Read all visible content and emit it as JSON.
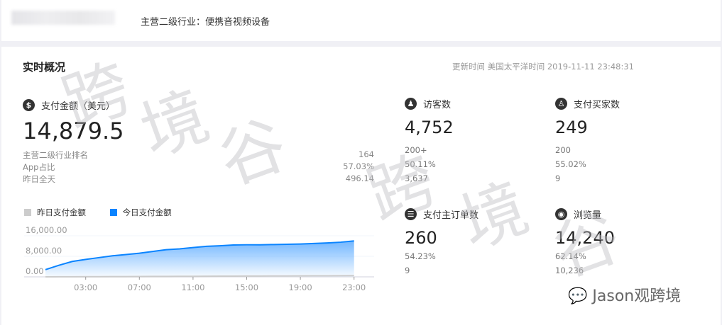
{
  "header": {
    "industry": "主营二级行业：便携音视频设备"
  },
  "panel": {
    "title": "实时概况",
    "update_time": "更新时间 美国太平洋时间 2019-11-11 23:48:31"
  },
  "payment": {
    "label": "支付金额（美元）",
    "value": "14,879.5",
    "rows": [
      {
        "label": "主营二级行业排名",
        "value": "164"
      },
      {
        "label": "App占比",
        "value": "57.03%"
      },
      {
        "label": "昨日全天",
        "value": "496.14"
      }
    ]
  },
  "metrics": [
    {
      "icon": "footprint-icon",
      "glyph": "♟",
      "label": "访客数",
      "value": "4,752",
      "sub": [
        "200+",
        "50.11%",
        "3,637"
      ]
    },
    {
      "icon": "buyers-icon",
      "glyph": "♙",
      "label": "支付买家数",
      "value": "249",
      "sub": [
        "200",
        "55.02%",
        "9"
      ]
    },
    {
      "icon": "order-icon",
      "glyph": "☰",
      "label": "支付主订单数",
      "value": "260",
      "sub": [
        "54.23%",
        "9"
      ]
    },
    {
      "icon": "eye-icon",
      "glyph": "◉",
      "label": "浏览量",
      "value": "14,240",
      "sub": [
        "62.14%",
        "10,236"
      ]
    }
  ],
  "watermark": [
    "跨",
    "境",
    "谷",
    "跨",
    "境",
    "谷"
  ],
  "brand": "Jason观跨境",
  "colors": {
    "today": "#0a84ff",
    "yesterday": "#cccccc"
  },
  "chart_data": {
    "type": "area",
    "legend": [
      "昨日支付金额",
      "今日支付金额"
    ],
    "x": [
      0,
      1,
      2,
      3,
      4,
      5,
      6,
      7,
      8,
      9,
      10,
      11,
      12,
      13,
      14,
      15,
      16,
      17,
      18,
      19,
      20,
      21,
      22,
      23
    ],
    "xticks": [
      "03:00",
      "07:00",
      "11:00",
      "15:00",
      "19:00",
      "23:00"
    ],
    "xtick_hours": [
      3,
      7,
      11,
      15,
      19,
      23
    ],
    "yticks": [
      "0.00",
      "8,000.00",
      "16,000.00"
    ],
    "ylim": [
      0,
      16000
    ],
    "series": [
      {
        "name": "今日支付金额",
        "values": [
          2800,
          4500,
          6000,
          6800,
          7500,
          8200,
          8700,
          9200,
          9900,
          10600,
          10900,
          11400,
          11900,
          12100,
          12400,
          12500,
          12500,
          12600,
          12700,
          12800,
          13000,
          13200,
          13500,
          14000
        ]
      },
      {
        "name": "昨日支付金额",
        "values": [
          0,
          20,
          40,
          60,
          80,
          100,
          120,
          140,
          160,
          180,
          200,
          220,
          240,
          260,
          280,
          300,
          320,
          340,
          360,
          380,
          400,
          420,
          450,
          496
        ]
      }
    ]
  }
}
